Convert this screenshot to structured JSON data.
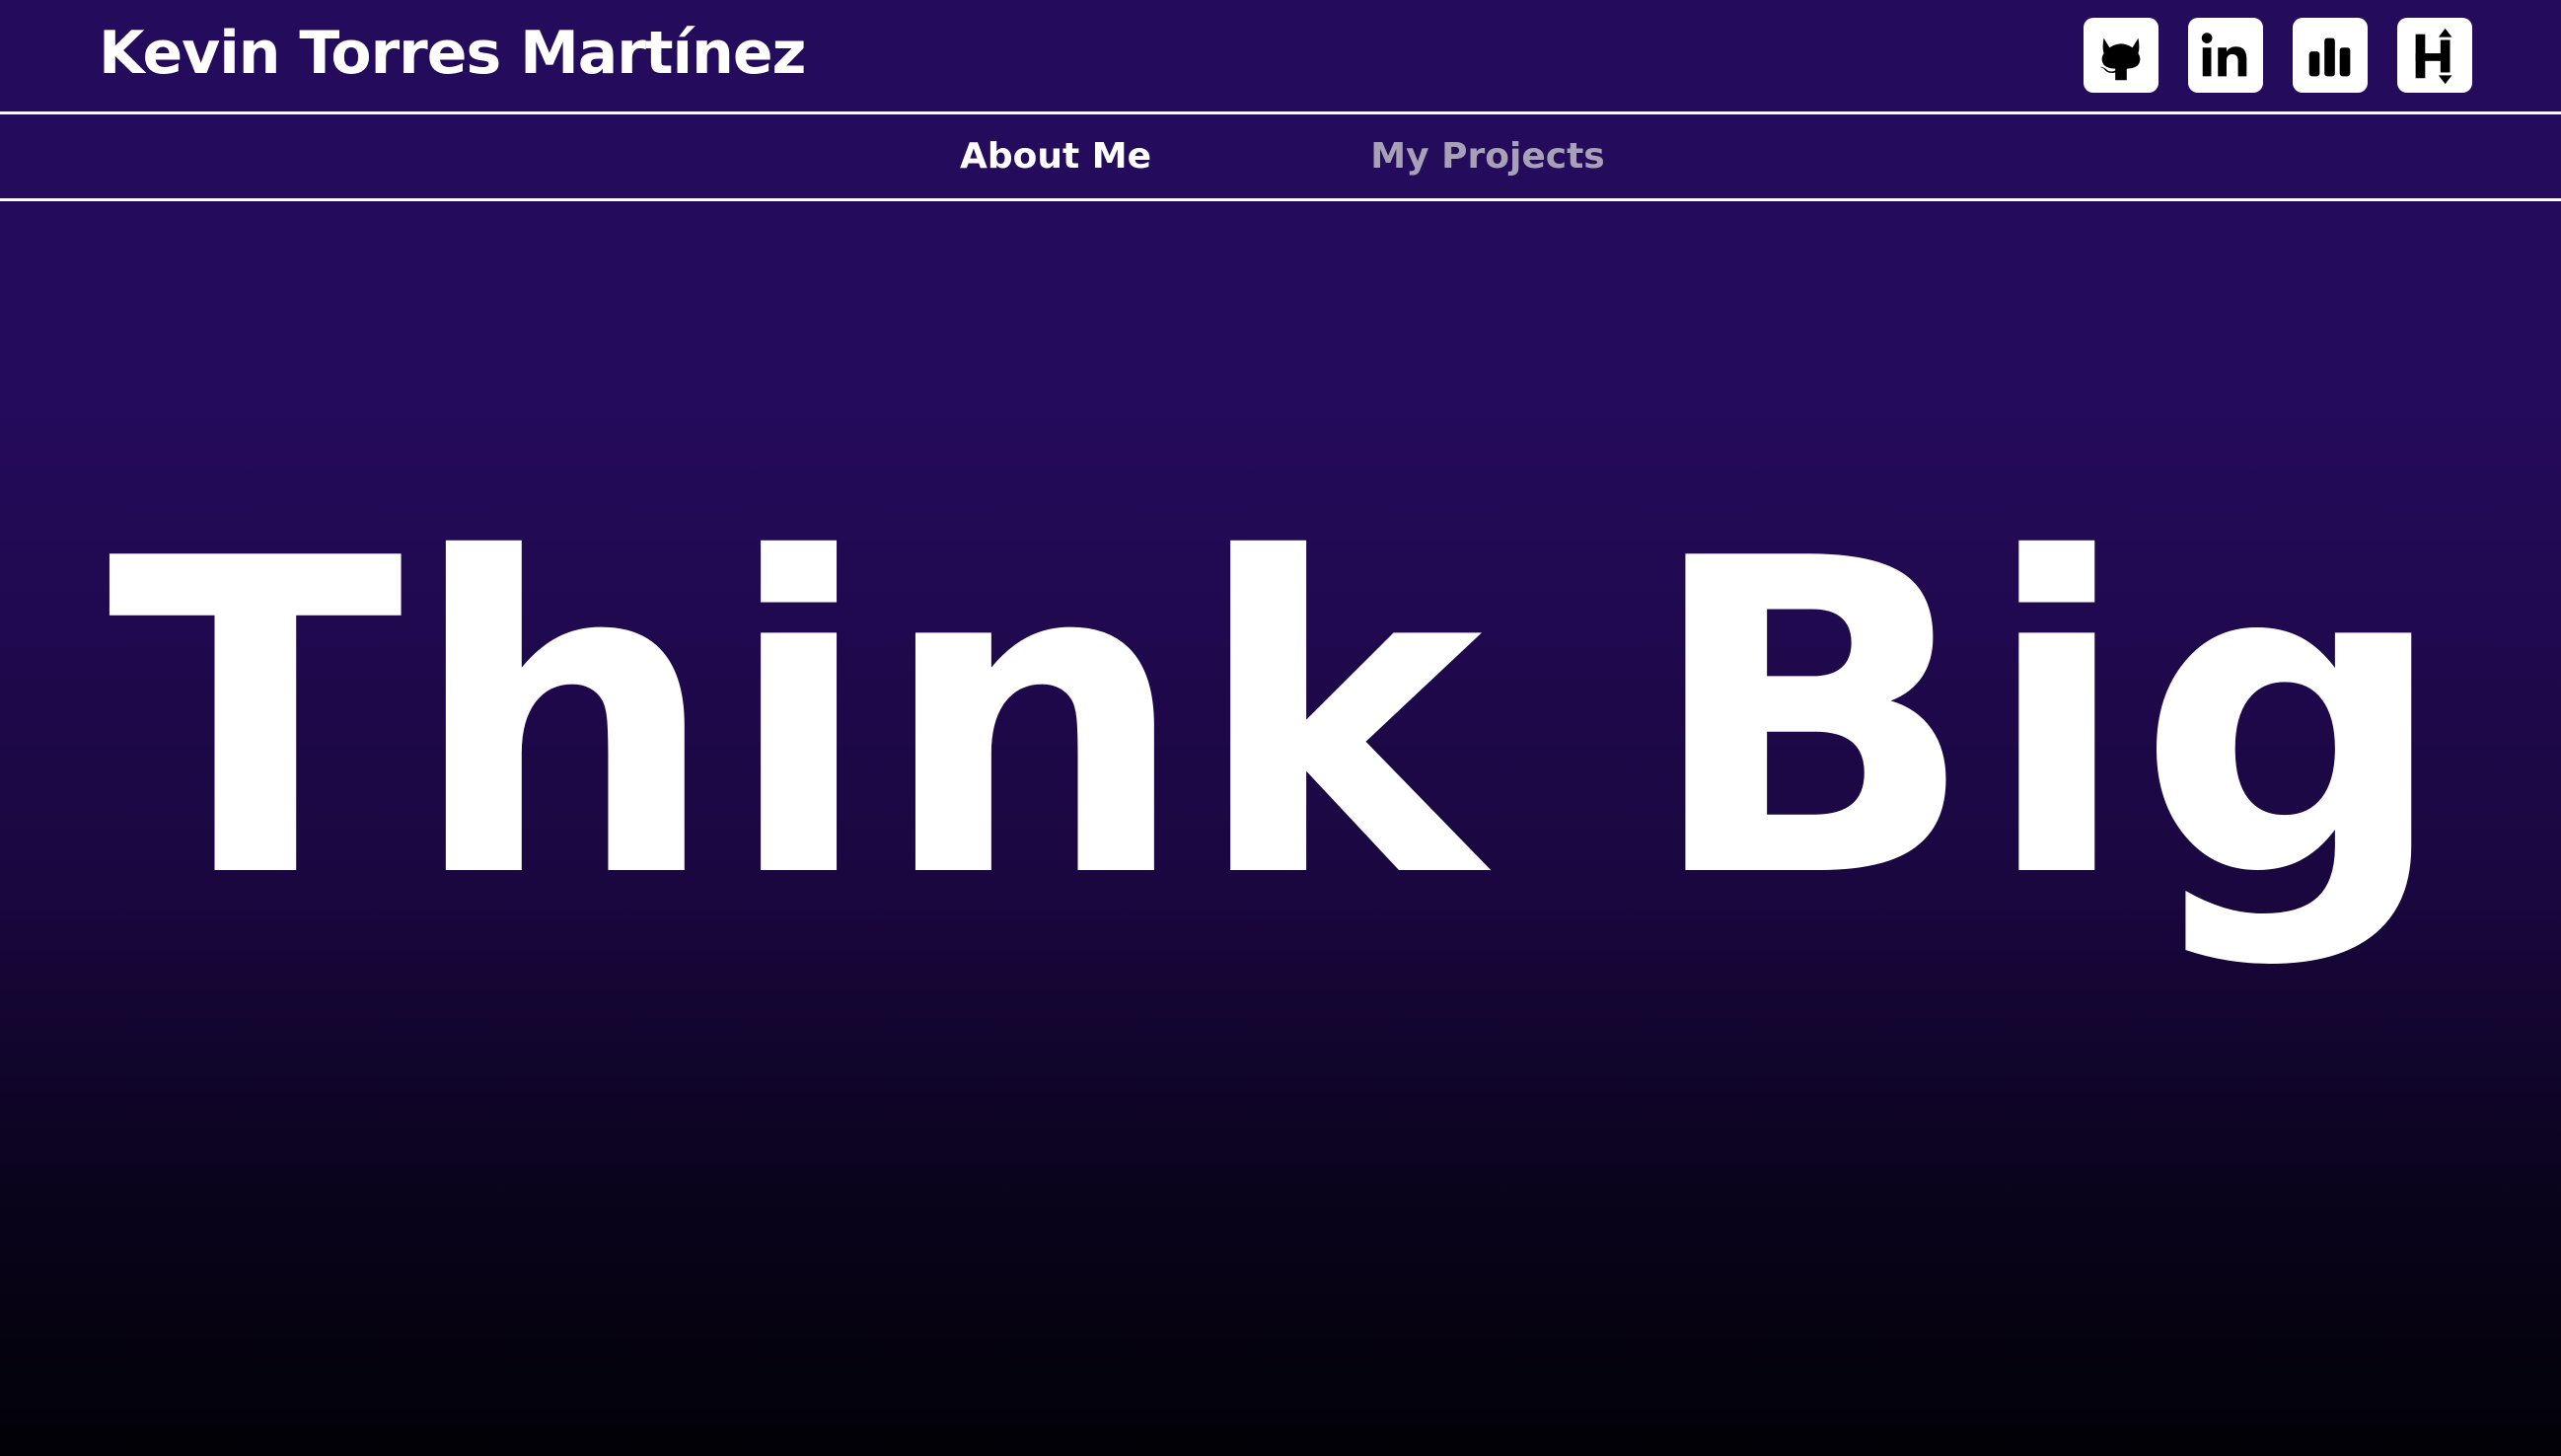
{
  "header": {
    "site_title": "Kevin Torres Martínez",
    "socials": [
      {
        "icon": "github-icon"
      },
      {
        "icon": "linkedin-icon"
      },
      {
        "icon": "bar-chart-icon"
      },
      {
        "icon": "hashnode-icon"
      }
    ]
  },
  "nav": {
    "items": [
      {
        "label": "About Me",
        "active": true
      },
      {
        "label": "My Projects",
        "active": false
      }
    ]
  },
  "hero": {
    "headline": "Think Big"
  },
  "colors": {
    "background_top": "#250b5c",
    "background_bottom": "#020106",
    "text": "#ffffff",
    "nav_inactive": "#a7a0b6"
  }
}
